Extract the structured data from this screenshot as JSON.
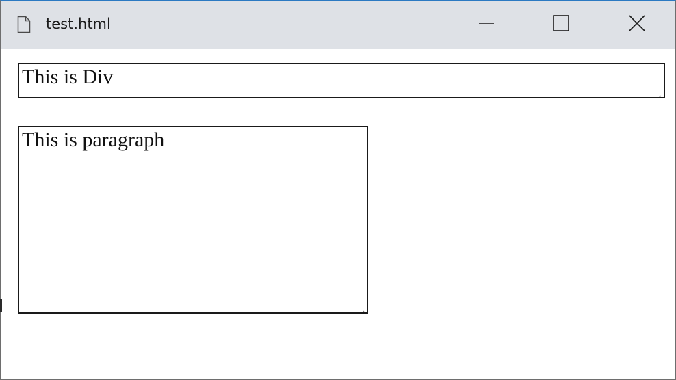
{
  "window": {
    "title": "test.html",
    "icon": "document-icon",
    "controls": [
      "minimize-icon",
      "maximize-icon",
      "close-icon"
    ]
  },
  "content": {
    "div_text": "This is Div",
    "paragraph_text": "This is paragraph"
  },
  "colors": {
    "titlebar_bg": "#dee1e6",
    "border": "#1a1a1a",
    "text": "#111111"
  }
}
